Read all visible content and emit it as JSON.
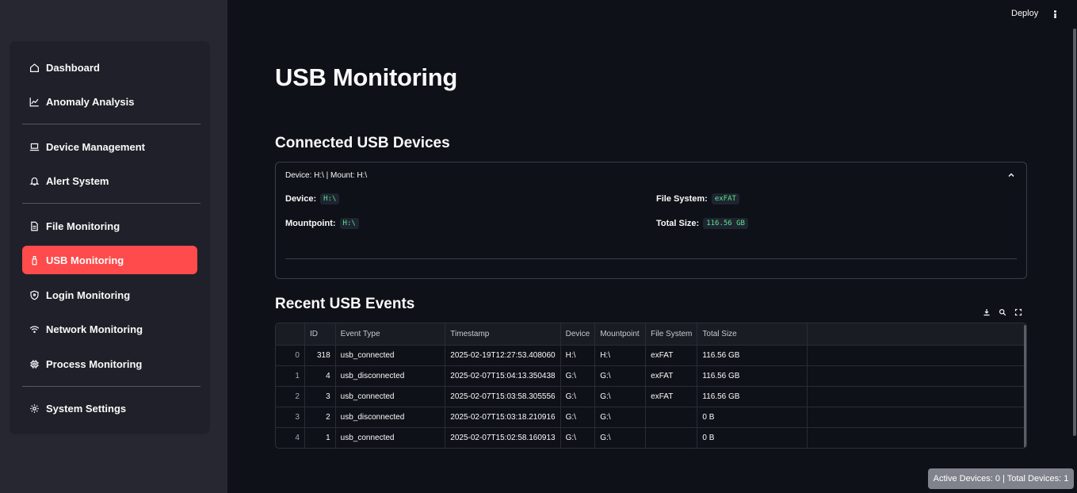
{
  "topbar": {
    "deploy_label": "Deploy"
  },
  "sidebar": {
    "items": [
      {
        "label": "Dashboard",
        "icon": "home-icon"
      },
      {
        "label": "Anomaly Analysis",
        "icon": "chart-line-icon"
      },
      {
        "label": "Device Management",
        "icon": "laptop-icon"
      },
      {
        "label": "Alert System",
        "icon": "bell-icon"
      },
      {
        "label": "File Monitoring",
        "icon": "file-icon"
      },
      {
        "label": "USB Monitoring",
        "icon": "usb-icon",
        "active": true
      },
      {
        "label": "Login Monitoring",
        "icon": "shield-icon"
      },
      {
        "label": "Network Monitoring",
        "icon": "wifi-icon"
      },
      {
        "label": "Process Monitoring",
        "icon": "cpu-icon"
      },
      {
        "label": "System Settings",
        "icon": "gear-icon"
      }
    ]
  },
  "main": {
    "title": "USB Monitoring",
    "connected_section_title": "Connected USB Devices",
    "device": {
      "header": "Device: H:\\ | Mount: H:\\",
      "device_label": "Device:",
      "device_value": "H:\\",
      "mount_label": "Mountpoint:",
      "mount_value": "H:\\",
      "fs_label": "File System:",
      "fs_value": "exFAT",
      "size_label": "Total Size:",
      "size_value": "116.56 GB"
    },
    "events_section_title": "Recent USB Events",
    "events_table": {
      "columns": [
        "",
        "ID",
        "Event Type",
        "Timestamp",
        "Device",
        "Mountpoint",
        "File System",
        "Total Size"
      ],
      "rows": [
        [
          "0",
          "318",
          "usb_connected",
          "2025-02-19T12:27:53.408060",
          "H:\\",
          "H:\\",
          "exFAT",
          "116.56 GB"
        ],
        [
          "1",
          "4",
          "usb_disconnected",
          "2025-02-07T15:04:13.350438",
          "G:\\",
          "G:\\",
          "exFAT",
          "116.56 GB"
        ],
        [
          "2",
          "3",
          "usb_connected",
          "2025-02-07T15:03:58.305556",
          "G:\\",
          "G:\\",
          "exFAT",
          "116.56 GB"
        ],
        [
          "3",
          "2",
          "usb_disconnected",
          "2025-02-07T15:03:18.210916",
          "G:\\",
          "G:\\",
          "",
          "0 B"
        ],
        [
          "4",
          "1",
          "usb_connected",
          "2025-02-07T15:02:58.160913",
          "G:\\",
          "G:\\",
          "",
          "0 B"
        ]
      ]
    }
  },
  "status_bar": {
    "text": "Active Devices: 0 | Total Devices: 1"
  },
  "colors": {
    "accent": "#ff4b4b",
    "code_green": "#5ce488",
    "sidebar_bg": "#262730",
    "main_bg": "#0e1117"
  }
}
